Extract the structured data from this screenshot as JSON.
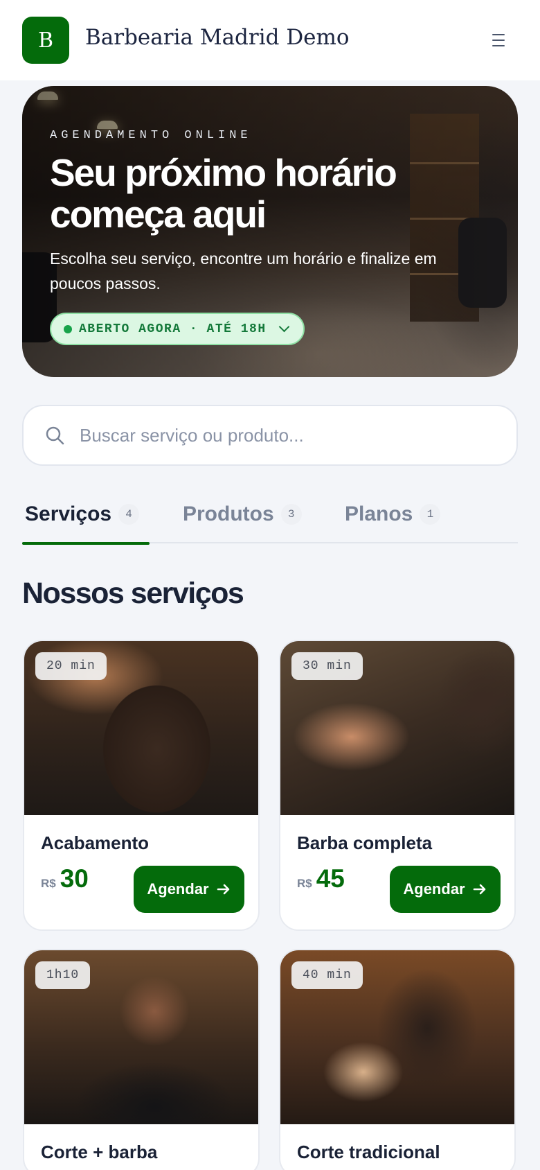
{
  "header": {
    "logo_letter": "B",
    "brand": "Barbearia Madrid Demo",
    "menu_icon": "hamburger-menu-icon"
  },
  "hero": {
    "eyebrow": "AGENDAMENTO ONLINE",
    "title": "Seu próximo horário começa aqui",
    "subtitle": "Escolha seu serviço, encontre um horário e finalize em poucos passos.",
    "status": "ABERTO AGORA · ATÉ 18H",
    "status_color": "#17a34a"
  },
  "search": {
    "placeholder": "Buscar serviço ou produto...",
    "value": ""
  },
  "tabs": [
    {
      "label": "Serviços",
      "count": "4",
      "active": true
    },
    {
      "label": "Produtos",
      "count": "3",
      "active": false
    },
    {
      "label": "Planos",
      "count": "1",
      "active": false
    }
  ],
  "section_title": "Nossos serviços",
  "services": [
    {
      "name": "Acabamento",
      "duration": "20 min",
      "currency": "R$",
      "price": "30",
      "cta": "Agendar"
    },
    {
      "name": "Barba completa",
      "duration": "30 min",
      "currency": "R$",
      "price": "45",
      "cta": "Agendar"
    },
    {
      "name": "Corte + barba",
      "duration": "1h10",
      "currency": "",
      "price": "",
      "cta": ""
    },
    {
      "name": "Corte tradicional",
      "duration": "40 min",
      "currency": "",
      "price": "",
      "cta": ""
    }
  ],
  "colors": {
    "brand_green": "#046b0b",
    "background": "#f3f5f9"
  }
}
